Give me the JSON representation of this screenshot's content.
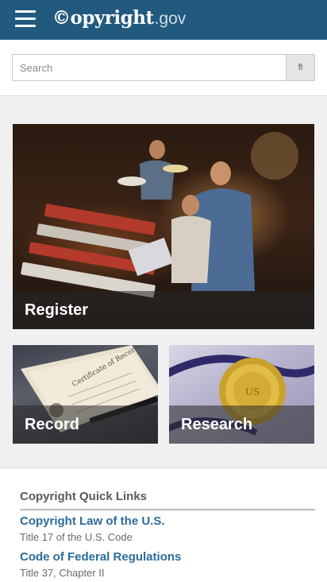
{
  "header": {
    "logo_mark": "©opyright",
    "logo_tld": ".gov",
    "menu_icon": "hamburger-menu-icon"
  },
  "search": {
    "placeholder": "Search",
    "value": "",
    "button_icon": "search-icon",
    "button_glyph": "fl"
  },
  "tiles": [
    {
      "label": "Register"
    },
    {
      "label": "Record"
    },
    {
      "label": "Research"
    }
  ],
  "quick_links": {
    "title": "Copyright Quick Links",
    "items": [
      {
        "label": "Copyright Law of the U.S.",
        "sub": "Title 17 of the U.S. Code"
      },
      {
        "label": "Code of Federal Regulations",
        "sub": "Title 37, Chapter II"
      }
    ]
  },
  "colors": {
    "header_bg": "#215a7e",
    "link": "#2d6b9a",
    "panel_bg": "#f0f0f0"
  }
}
